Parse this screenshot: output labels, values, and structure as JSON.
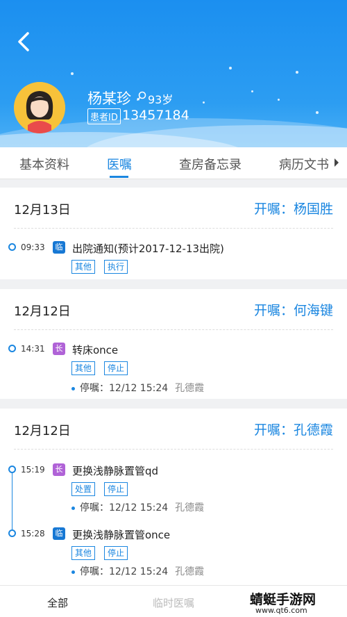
{
  "header": {
    "patient_name": "杨某珍",
    "age": "93岁",
    "id_label": "患者ID",
    "id_number": "13457184"
  },
  "tabs": [
    {
      "label": "基本资料"
    },
    {
      "label": "医嘱"
    },
    {
      "label": "查房备忘录"
    },
    {
      "label": "病历文书"
    }
  ],
  "cards": [
    {
      "date": "12月13日",
      "doctor": "开嘱：杨国胜",
      "entries": [
        {
          "time": "09:33",
          "type": "临",
          "title": "出院通知(预计2017-12-13出院)",
          "tags": [
            "其他",
            "执行"
          ]
        }
      ]
    },
    {
      "date": "12月12日",
      "doctor": "开嘱：何海键",
      "entries": [
        {
          "time": "14:31",
          "type": "长",
          "title": "转床once",
          "tags": [
            "其他",
            "停止"
          ],
          "stop_label": "停嘱：",
          "stop_time": "12/12 15:24",
          "stop_doctor": "孔德霞"
        }
      ]
    },
    {
      "date": "12月12日",
      "doctor": "开嘱：孔德霞",
      "entries": [
        {
          "time": "15:19",
          "type": "长",
          "title": "更换浅静脉置管qd",
          "tags": [
            "处置",
            "停止"
          ],
          "stop_label": "停嘱：",
          "stop_time": "12/12 15:24",
          "stop_doctor": "孔德霞"
        },
        {
          "time": "15:28",
          "type": "临",
          "title": "更换浅静脉置管once",
          "tags": [
            "其他",
            "停止"
          ],
          "stop_label": "停嘱：",
          "stop_time": "12/12 15:24",
          "stop_doctor": "孔德霞"
        }
      ]
    }
  ],
  "bottom_bar": {
    "all_label": "全部",
    "temp_label": "临时医嘱"
  },
  "watermark": {
    "text": "蜻蜓手游网",
    "url": "www.qt6.com"
  },
  "colors": {
    "primary": "#1a86e0",
    "header": "#2c9df2",
    "long_term": "#b063d7",
    "temporary": "#1778d4"
  }
}
